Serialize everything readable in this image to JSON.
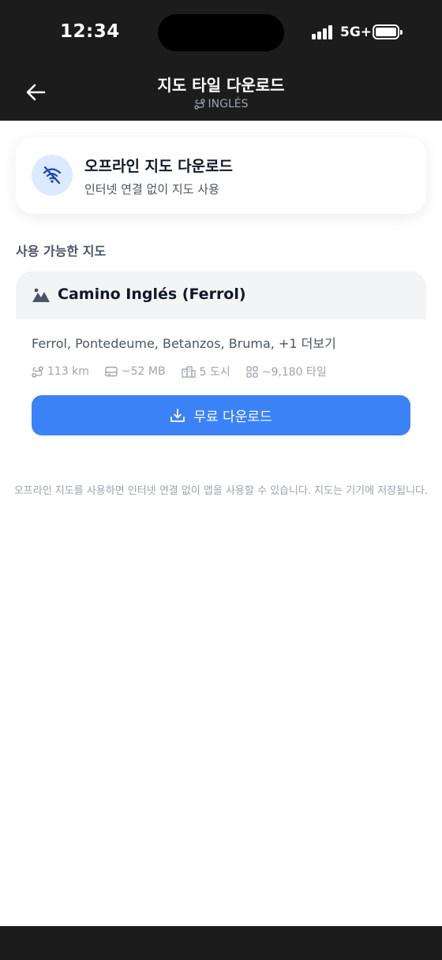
{
  "status_bar": {
    "time": "12:34",
    "network": "5G+"
  },
  "header": {
    "title": "지도 타일 다운로드",
    "subtitle": "INGLÉS",
    "subtitle_icon": "route-icon",
    "back_icon": "arrow-left-icon"
  },
  "offline_card": {
    "title": "오프라인 지도 다운로드",
    "subtitle": "인터넷 연결 없이 지도 사용",
    "icon": "wifi-off-icon"
  },
  "section_label": "사용 가능한 지도",
  "map_item": {
    "name": "Camino Inglés (Ferrol)",
    "stops": "Ferrol, Pontedeume, Betanzos, Bruma, +1 더보기",
    "stats": {
      "distance": "113 km",
      "size": "~52 MB",
      "cities": "5 도시",
      "tiles": "~9,180 타일"
    },
    "download_label": "무료 다운로드"
  },
  "footnote": "오프라인 지도를 사용하면 인터넷 연결 없이 앱을 사용할 수 있습니다. 지도는 기기에 저장됩니다.",
  "colors": {
    "accent": "#3b82f6",
    "bars": "#1c1c1c"
  }
}
